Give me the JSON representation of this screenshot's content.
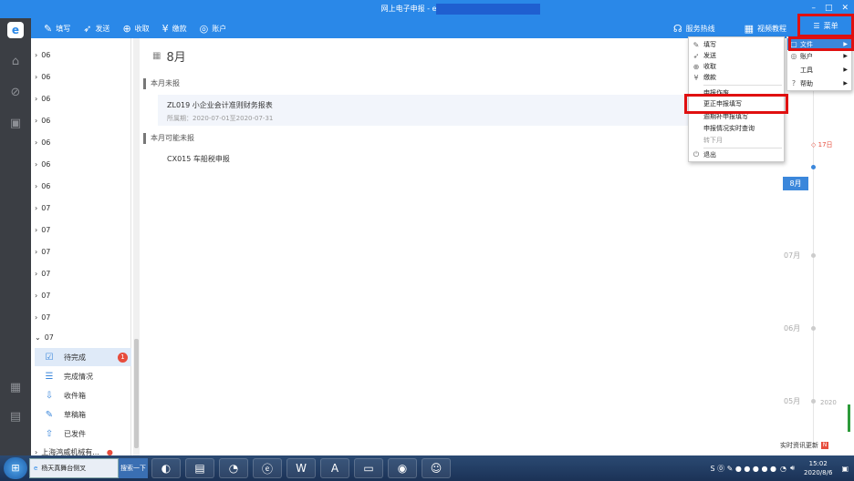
{
  "window": {
    "title": "网上电子申报 - eTax@SH 3",
    "min": "–",
    "max": "□",
    "close": "✕"
  },
  "toolbar": {
    "items": [
      {
        "label": "填写",
        "icon": "edit-icon"
      },
      {
        "label": "发送",
        "icon": "send-icon"
      },
      {
        "label": "收取",
        "icon": "download-icon"
      },
      {
        "label": "缴款",
        "icon": "yen-icon"
      },
      {
        "label": "账户",
        "icon": "account-icon"
      }
    ],
    "hotline": "服务热线",
    "video": "视频教程",
    "menu": "菜单"
  },
  "tree": {
    "rows": [
      "06",
      "06",
      "06",
      "06",
      "06",
      "06",
      "06",
      "07",
      "07",
      "07",
      "07",
      "07",
      "07",
      "07"
    ],
    "subitems": [
      {
        "label": "待完成",
        "badge": "1"
      },
      {
        "label": "完成情况"
      },
      {
        "label": "收件箱"
      },
      {
        "label": "草稿箱"
      },
      {
        "label": "已发件"
      }
    ],
    "company": "上海鸿威机械有..."
  },
  "main": {
    "month": "8月",
    "section1": "本月未报",
    "card": {
      "title": "ZL019 小企业会计准则财务报表",
      "period": "所属期：2020-07-01至2020-07-31"
    },
    "section2": "本月可能未报",
    "item2": "CX015 车船税申报"
  },
  "timeline": {
    "marker": "17日",
    "current": "8月",
    "labels": [
      "07月",
      "06月",
      "05月"
    ],
    "year": "2020",
    "news": "实时资讯更新",
    "news_badge": "N"
  },
  "menu_left": {
    "items": [
      "填写",
      "发送",
      "收取",
      "缴款",
      "申报作废",
      "更正申报填写",
      "逾期补申报填写",
      "申报情况实时查询",
      "转下月",
      "退出"
    ]
  },
  "menu_right": {
    "items": [
      "文件",
      "账户",
      "工具",
      "帮助"
    ]
  },
  "taskbar": {
    "task1": "杨天真舞台侧叉",
    "search": "搜索一下",
    "time": "15:02",
    "date": "2020/8/6"
  }
}
